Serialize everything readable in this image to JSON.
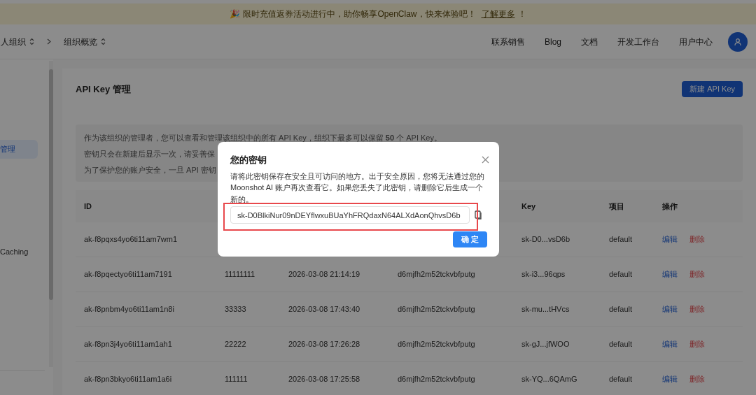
{
  "banner": {
    "emoji": "🎉",
    "text": "限时充值返券活动进行中，助你畅享OpenClaw，快来体验吧！",
    "link": "了解更多",
    "suffix": "！"
  },
  "breadcrumb": [
    {
      "label": "人组织",
      "dropdown": true
    },
    {
      "label": "组织概览",
      "dropdown": true
    }
  ],
  "nav": [
    "联系销售",
    "Blog",
    "文档",
    "开发工作台",
    "用户中心"
  ],
  "sidebar": {
    "items": [
      {
        "label": "管理",
        "selected": true
      },
      {
        "label": "Caching",
        "selected": false
      }
    ]
  },
  "page": {
    "title": "API Key 管理",
    "new_button": "新建 API Key",
    "info_lines": [
      "作为该组织的管理者，您可以查看和管理该组织中的所有 API Key，组织下最多可以保留 **50** 个 API Key。",
      "密钥只会在新建后显示一次，请妥善保",
      "为了保护您的账户安全，一旦 API 密钥"
    ]
  },
  "table": {
    "columns": {
      "id": "ID",
      "key": "Key",
      "project": "项目",
      "actions": "操作"
    },
    "rows": [
      {
        "id": "ak-f8pqxs4yo6ti11am7wm1",
        "key": "sk-D0...vsD6b",
        "project": "default",
        "edit": "编辑",
        "delete": "删除"
      },
      {
        "id": "ak-f8pqectyo6ti11am7191",
        "name": "11111111",
        "created": "2026-03-08 21:14:19",
        "project_id": "d6mjfh2m52tckvbfputg",
        "key": "sk-i3...96qps",
        "project": "default",
        "edit": "编辑",
        "delete": "删除"
      },
      {
        "id": "ak-f8pnbm4yo6ti11am1n8i",
        "name": "33333",
        "created": "2026-03-08 17:43:40",
        "project_id": "d6mjfh2m52tckvbfputg",
        "key": "sk-mu...tHVcs",
        "project": "default",
        "edit": "编辑",
        "delete": "删除"
      },
      {
        "id": "ak-f8pn3j4yo6ti11am1ah1",
        "name": "22222",
        "created": "2026-03-08 17:26:28",
        "project_id": "d6mjfh2m52tckvbfputg",
        "key": "sk-gJ...jfWOO",
        "project": "default",
        "edit": "编辑",
        "delete": "删除"
      },
      {
        "id": "ak-f8pn3bkyo6ti11am1a6i",
        "name": "111111",
        "created": "2026-03-08 17:25:58",
        "project_id": "d6mjfh2m52tckvbfputg",
        "key": "sk-YQ...6QAmG",
        "project": "default",
        "edit": "编辑",
        "delete": "删除"
      }
    ]
  },
  "modal": {
    "title": "您的密钥",
    "message": "请将此密钥保存在安全且可访问的地方。出于安全原因，您将无法通过您的 Moonshot AI 账户再次查看它。如果您丢失了此密钥，请删除它后生成一个新的。",
    "key_value": "sk-D0BlkiNur09nDEYflwxuBUaYhFRQdaxN64ALXdAonQhvsD6b",
    "confirm": "确 定",
    "highlighted": true
  }
}
